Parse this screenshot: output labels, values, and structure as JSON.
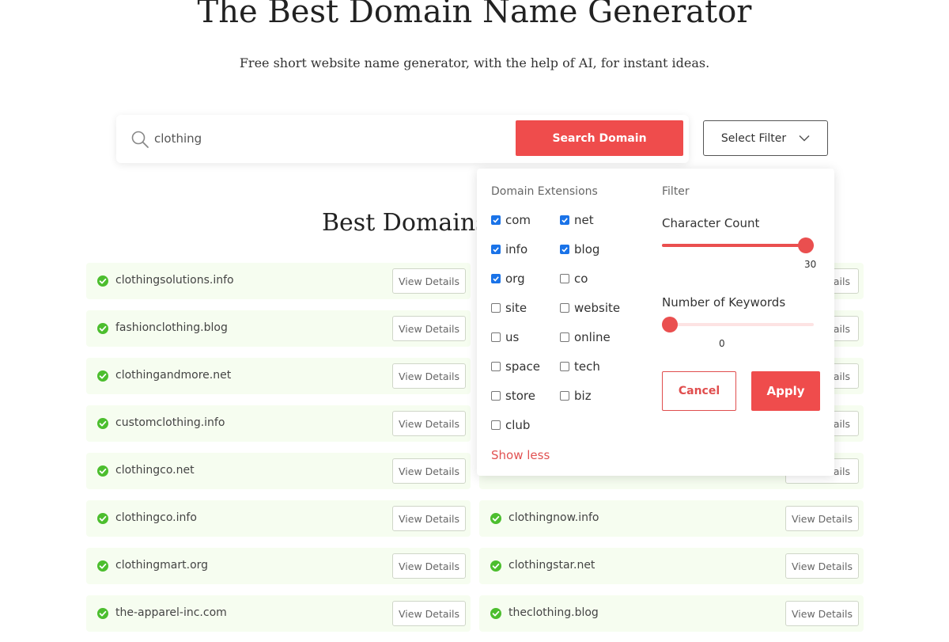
{
  "header": {
    "title": "The Best Domain Name Generator",
    "subtitle": "Free short website name generator, with the help of AI, for instant ideas."
  },
  "search": {
    "value": "clothing",
    "button_label": "Search Domain",
    "filter_label": "Select Filter"
  },
  "results": {
    "title": "Best Domains",
    "view_details_label": "View Details",
    "left_column": [
      "clothingsolutions.info",
      "fashionclothing.blog",
      "clothingandmore.net",
      "customclothing.info",
      "clothingco.net",
      "clothingco.info",
      "clothingmart.org",
      "the-apparel-inc.com"
    ],
    "right_column": [
      "clothingnow.info",
      "clothingstar.net",
      "theclothing.blog"
    ],
    "partial_right_label": "ails"
  },
  "filter_panel": {
    "extensions_heading": "Domain Extensions",
    "filter_heading": "Filter",
    "extensions": [
      {
        "label": "com",
        "checked": true
      },
      {
        "label": "net",
        "checked": true
      },
      {
        "label": "info",
        "checked": true
      },
      {
        "label": "blog",
        "checked": true
      },
      {
        "label": "org",
        "checked": true
      },
      {
        "label": "co",
        "checked": false
      },
      {
        "label": "site",
        "checked": false
      },
      {
        "label": "website",
        "checked": false
      },
      {
        "label": "us",
        "checked": false
      },
      {
        "label": "online",
        "checked": false
      },
      {
        "label": "space",
        "checked": false
      },
      {
        "label": "tech",
        "checked": false
      },
      {
        "label": "store",
        "checked": false
      },
      {
        "label": "biz",
        "checked": false
      },
      {
        "label": "club",
        "checked": false
      }
    ],
    "show_less_label": "Show less",
    "character_count": {
      "label": "Character Count",
      "value": 30,
      "min": 0,
      "max": 30
    },
    "keywords": {
      "label": "Number of Keywords",
      "value": 0,
      "min": 0,
      "max": 5
    },
    "cancel_label": "Cancel",
    "apply_label": "Apply"
  },
  "colors": {
    "accent": "#ef4c4c",
    "check_green": "#4cbe2e",
    "row_background": "#f6fdf0",
    "checkbox_blue": "#1a73e8"
  }
}
